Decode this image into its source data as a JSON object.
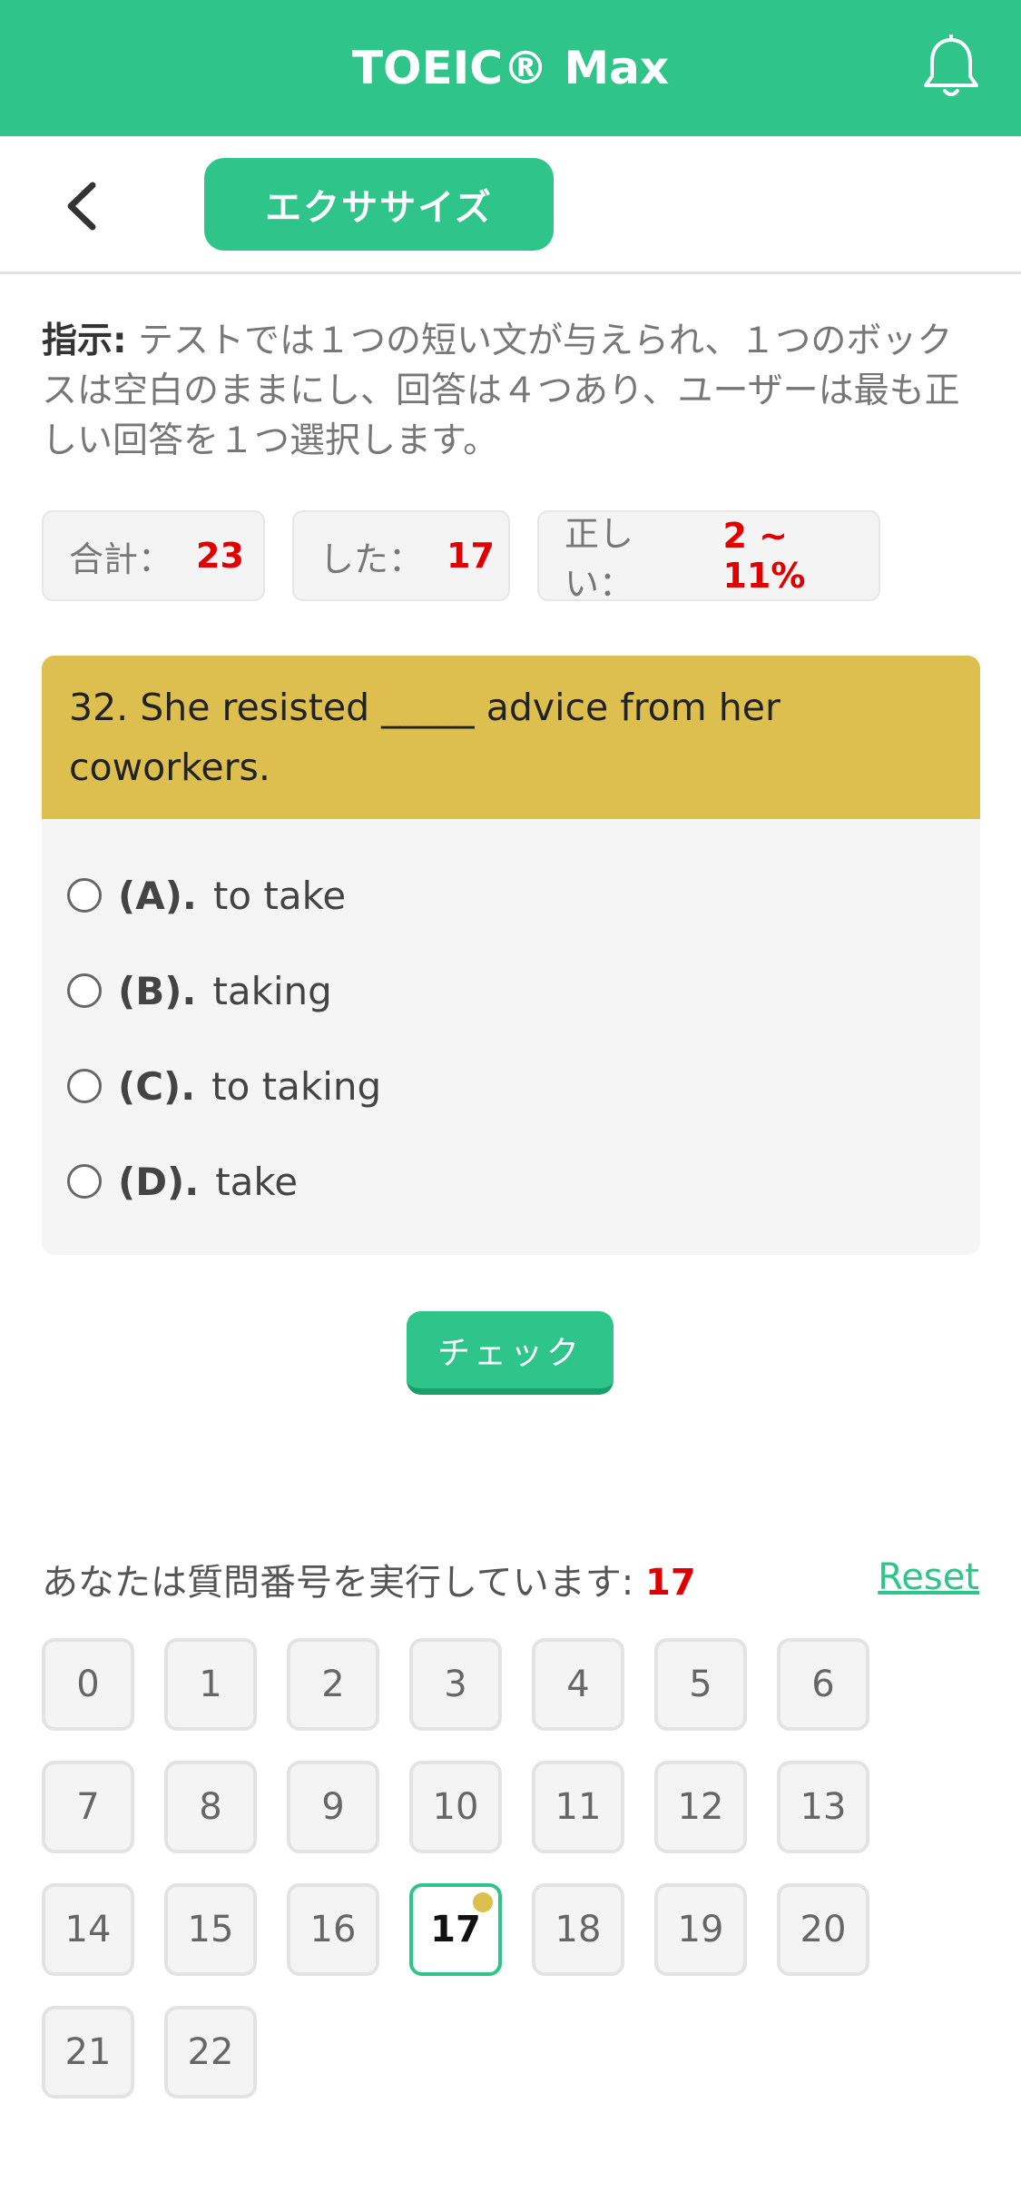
{
  "header": {
    "title": "TOEIC® Max",
    "bell_icon": "bell-icon"
  },
  "subbar": {
    "back_icon": "chevron-left-icon",
    "tab_label": "エクササイズ"
  },
  "instructions": {
    "label": "指示:",
    "text": " テストでは１つの短い文が与えられ、１つのボックスは空白のままにし、回答は４つあり、ユーザーは最も正しい回答を１つ選択します。"
  },
  "stats": {
    "total_label": "合計：",
    "total_value": "23",
    "done_label": "した：",
    "done_value": "17",
    "correct_label": "正しい：",
    "correct_value": "2 ~ 11%"
  },
  "question": {
    "text": "32. She resisted _____ advice from her coworkers.",
    "options": [
      {
        "letter": "(A).",
        "text": "to take"
      },
      {
        "letter": "(B).",
        "text": "taking"
      },
      {
        "letter": "(C).",
        "text": "to taking"
      },
      {
        "letter": "(D).",
        "text": "take"
      }
    ]
  },
  "check_label": "チェック",
  "progress": {
    "label": "あなたは質問番号を実行しています: ",
    "current": "17",
    "reset_label": "Reset"
  },
  "question_numbers": [
    "0",
    "1",
    "2",
    "3",
    "4",
    "5",
    "6",
    "7",
    "8",
    "9",
    "10",
    "11",
    "12",
    "13",
    "14",
    "15",
    "16",
    "17",
    "18",
    "19",
    "20",
    "21",
    "22"
  ],
  "active_index": 17,
  "colors": {
    "accent": "#2ec48a",
    "question_bg": "#dcbf4e",
    "highlight": "#e00000"
  }
}
